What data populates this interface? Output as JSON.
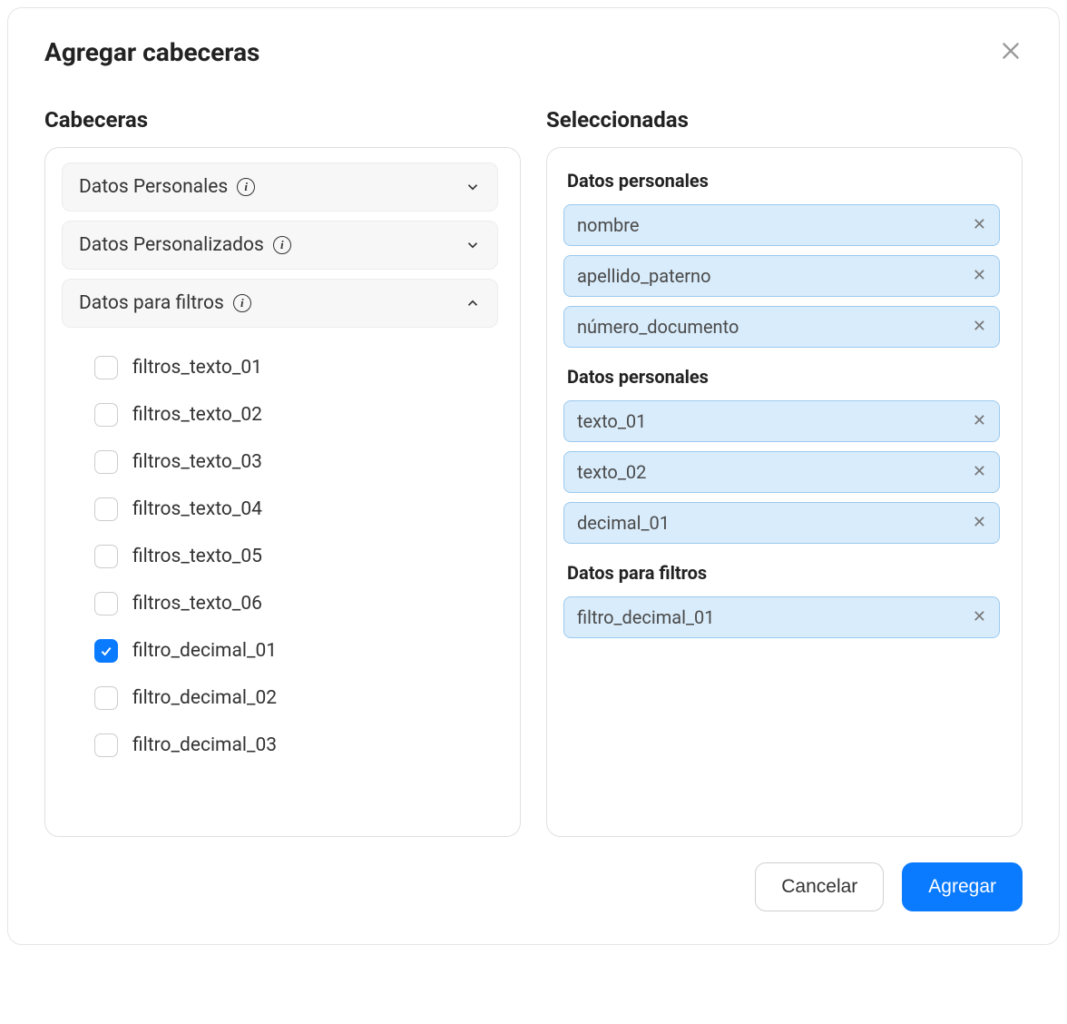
{
  "dialog": {
    "title": "Agregar cabeceras"
  },
  "left": {
    "title": "Cabeceras",
    "sections": [
      {
        "label": "Datos Personales",
        "expanded": false
      },
      {
        "label": "Datos Personalizados",
        "expanded": false
      },
      {
        "label": "Datos para filtros",
        "expanded": true
      }
    ],
    "filter_items": [
      {
        "label": "filtros_texto_01",
        "checked": false
      },
      {
        "label": "filtros_texto_02",
        "checked": false
      },
      {
        "label": "filtros_texto_03",
        "checked": false
      },
      {
        "label": "filtros_texto_04",
        "checked": false
      },
      {
        "label": "filtros_texto_05",
        "checked": false
      },
      {
        "label": "filtros_texto_06",
        "checked": false
      },
      {
        "label": "filtro_decimal_01",
        "checked": true
      },
      {
        "label": "filtro_decimal_02",
        "checked": false
      },
      {
        "label": "filtro_decimal_03",
        "checked": false
      }
    ]
  },
  "right": {
    "title": "Seleccionadas",
    "groups": [
      {
        "title": "Datos personales",
        "items": [
          "nombre",
          "apellido_paterno",
          "número_documento"
        ]
      },
      {
        "title": "Datos personales",
        "items": [
          "texto_01",
          "texto_02",
          "decimal_01"
        ]
      },
      {
        "title": "Datos para filtros",
        "items": [
          "filtro_decimal_01"
        ]
      }
    ]
  },
  "footer": {
    "cancel": "Cancelar",
    "submit": "Agregar"
  }
}
